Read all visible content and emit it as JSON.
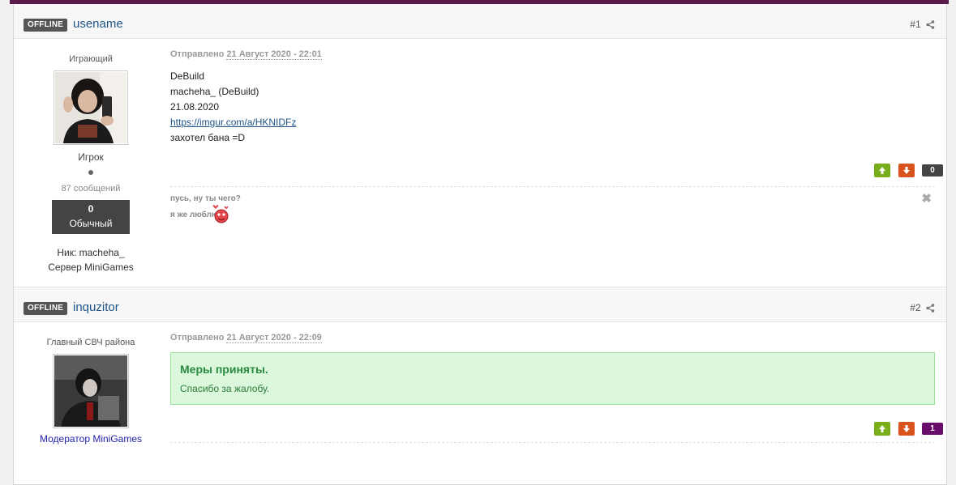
{
  "posts": [
    {
      "status": "OFFLINE",
      "username": "usename",
      "post_number": "#1",
      "rank_title": "Играющий",
      "group": "Игрок",
      "posts_count": "87 сообщений",
      "reputation": {
        "value": "0",
        "label": "Обычный"
      },
      "nick": "Ник: macheha_",
      "server": "Сервер MiniGames",
      "posted_label": "Отправлено",
      "posted_date": "21 Август 2020 - 22:01",
      "body": [
        "DeBuild",
        "macheha_ (DeBuild)",
        "21.08.2020",
        "https://imgur.com/a/HKNIDFz",
        "захотел бана =D"
      ],
      "vote_count": "0",
      "vote_color": "#444444",
      "signature": [
        "пусь, ну ты чего?",
        "я же люблю"
      ]
    },
    {
      "status": "OFFLINE",
      "username": "inquzitor",
      "post_number": "#2",
      "rank_title": "Главный СВЧ района",
      "group": "Модератор MiniGames",
      "group_color": "#2222aa",
      "posted_label": "Отправлено",
      "posted_date": "21 Август 2020 - 22:09",
      "notice_title": "Меры приняты.",
      "notice_text": "Спасибо за жалобу.",
      "vote_count": "1",
      "vote_color": "#6a0d6a"
    }
  ],
  "colors": {
    "topbar": "#5a1a4a",
    "username": "#1e5487",
    "vote_up": "#7aad1a",
    "vote_down": "#d9531e",
    "notice_bg": "#dbf7dc"
  },
  "icons": [
    "share-icon",
    "arrow-up-icon",
    "arrow-down-icon",
    "close-icon",
    "heart-smiley-icon"
  ]
}
